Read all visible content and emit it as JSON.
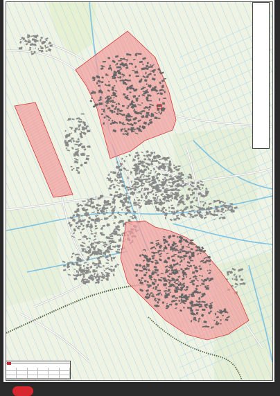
{
  "viewer": {
    "background": "#2b2b2b",
    "accent": "#d8262e"
  },
  "map": {
    "colors": {
      "land": "#eef3e4",
      "water_line": "#9fd3ec",
      "water_canal": "#7ec3e4",
      "road": "#ffffff",
      "road_casing": "#b9b9b9",
      "building": "#8a8a8a",
      "building_dark": "#666666",
      "highlight_fill": "#f2a0a0",
      "highlight_stroke": "#d23c3c",
      "highlight_hatch": "#e07070",
      "green": "#b8d7a5",
      "rail": "#5b6b4a"
    },
    "highlighted_zones": [
      "north-district",
      "west-strip",
      "south-district"
    ]
  },
  "legend": {
    "title": "",
    "lines": [
      "",
      "",
      "",
      "",
      "",
      "",
      "",
      "",
      "",
      "",
      "",
      "",
      "",
      "",
      "",
      "",
      "",
      "",
      "",
      "",
      "",
      "",
      "",
      "",
      "",
      "",
      "",
      "",
      "",
      "",
      "",
      "",
      "",
      "",
      "",
      "",
      "",
      "",
      "",
      "",
      "",
      "",
      "",
      ""
    ]
  },
  "title_block": {
    "heading": "",
    "cells": [
      "",
      "",
      "",
      "",
      "",
      "",
      "",
      "",
      "",
      "",
      "",
      "",
      "",
      "",
      "",
      "",
      "",
      ""
    ]
  }
}
